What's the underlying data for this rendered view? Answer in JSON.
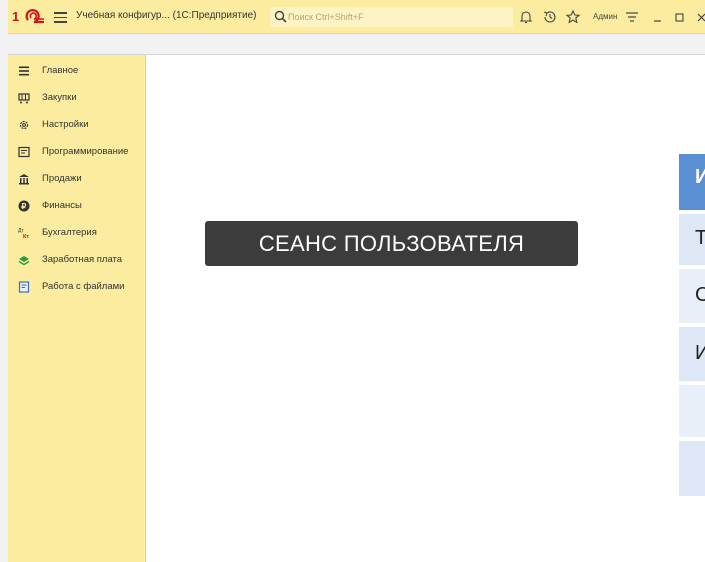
{
  "topbar": {
    "app_title": "Учебная конфигур...  (1С:Предприятие)",
    "search_placeholder": "Поиск Ctrl+Shift+F",
    "user_name": "Админ"
  },
  "sidebar": {
    "items": [
      {
        "label": "Главное",
        "icon": "menu-lines-icon"
      },
      {
        "label": "Закупки",
        "icon": "cart-icon"
      },
      {
        "label": "Настройки",
        "icon": "gear-icon"
      },
      {
        "label": "Программирование",
        "icon": "code-window-icon"
      },
      {
        "label": "Продажи",
        "icon": "shop-icon"
      },
      {
        "label": "Финансы",
        "icon": "ruble-icon"
      },
      {
        "label": "Бухгалтерия",
        "icon": "debit-credit-icon"
      },
      {
        "label": "Заработная плата",
        "icon": "money-icon"
      },
      {
        "label": "Работа с файлами",
        "icon": "file-icon"
      }
    ]
  },
  "main": {
    "session_banner": "СЕАНС ПОЛЬЗОВАТЕЛЯ",
    "tiles": [
      "И",
      "Т",
      "С",
      "И",
      "",
      ""
    ]
  },
  "colors": {
    "accent_yellow": "#fbeca0",
    "banner_bg": "#3c3c3c",
    "tile_blue": "#5b8fd4",
    "tile_light": "#dde7f5"
  }
}
